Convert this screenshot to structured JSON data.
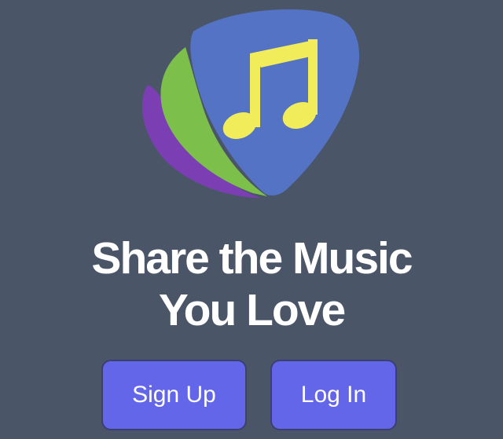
{
  "logo": {
    "name": "guitar-pick-music-note-logo",
    "colors": {
      "pick_front": "#5573c4",
      "pick_green": "#7cc04b",
      "pick_purple": "#7b3fb3",
      "note": "#f1ec5a"
    }
  },
  "headline": {
    "line1": "Share the Music",
    "line2": "You Love"
  },
  "buttons": {
    "signup_label": "Sign Up",
    "login_label": "Log In"
  },
  "colors": {
    "background": "#4a5568",
    "button": "#6366e8",
    "text": "#ffffff"
  }
}
